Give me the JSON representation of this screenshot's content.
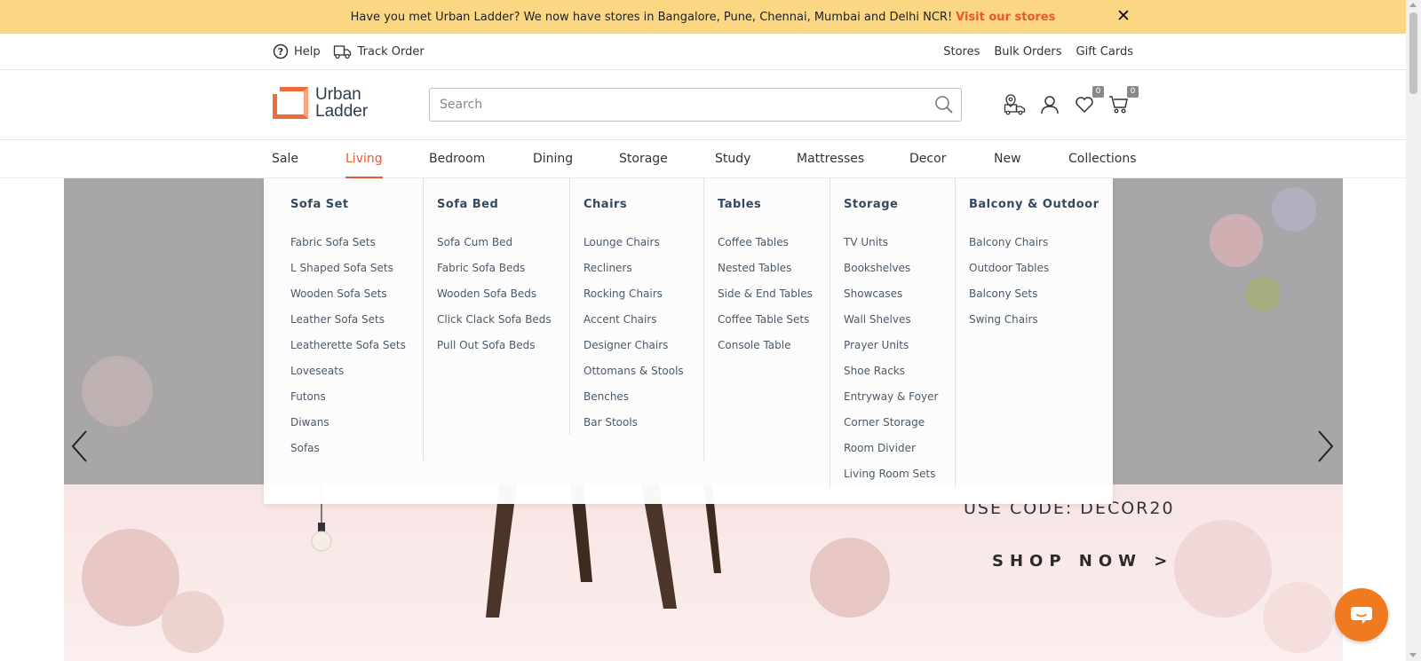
{
  "announcement": {
    "text": "Have you met Urban Ladder? We now have stores in Bangalore, Pune, Chennai, Mumbai and Delhi NCR!",
    "link": "Visit our stores",
    "close": "✕"
  },
  "utility": {
    "help": "Help",
    "track_order": "Track Order",
    "stores": "Stores",
    "bulk_orders": "Bulk Orders",
    "gift_cards": "Gift Cards"
  },
  "header": {
    "logo_line1": "Urban",
    "logo_line2": "Ladder",
    "search_placeholder": "Search",
    "wishlist_count": "0",
    "cart_count": "0"
  },
  "categories": [
    "Sale",
    "Living",
    "Bedroom",
    "Dining",
    "Storage",
    "Study",
    "Mattresses",
    "Decor",
    "New",
    "Collections"
  ],
  "active_category": "Living",
  "mega_menu": [
    {
      "title": "Sofa Set",
      "items": [
        "Fabric Sofa Sets",
        "L Shaped Sofa Sets",
        "Wooden Sofa Sets",
        "Leather Sofa Sets",
        "Leatherette Sofa Sets",
        "Loveseats",
        "Futons",
        "Diwans",
        "Sofas"
      ]
    },
    {
      "title": "Sofa Bed",
      "items": [
        "Sofa Cum Bed",
        "Fabric Sofa Beds",
        "Wooden Sofa Beds",
        "Click Clack Sofa Beds",
        "Pull Out Sofa Beds"
      ]
    },
    {
      "title": "Chairs",
      "items": [
        "Lounge Chairs",
        "Recliners",
        "Rocking Chairs",
        "Accent Chairs",
        "Designer Chairs",
        "Ottomans & Stools",
        "Benches",
        "Bar Stools"
      ]
    },
    {
      "title": "Tables",
      "items": [
        "Coffee Tables",
        "Nested Tables",
        "Side & End Tables",
        "Coffee Table Sets",
        "Console Table"
      ]
    },
    {
      "title": "Storage",
      "items": [
        "TV Units",
        "Bookshelves",
        "Showcases",
        "Wall Shelves",
        "Prayer Units",
        "Shoe Racks",
        "Entryway & Foyer",
        "Corner Storage",
        "Room Divider",
        "Living Room Sets"
      ]
    },
    {
      "title": "Balcony & Outdoor",
      "items": [
        "Balcony Chairs",
        "Outdoor Tables",
        "Balcony Sets",
        "Swing Chairs"
      ]
    }
  ],
  "hero": {
    "code": "USE CODE: DECOR20",
    "cta": "SHOP NOW >"
  },
  "colors": {
    "accent": "#e8592d",
    "announcement_bg": "#fbd784",
    "chat": "#f07a1f"
  }
}
